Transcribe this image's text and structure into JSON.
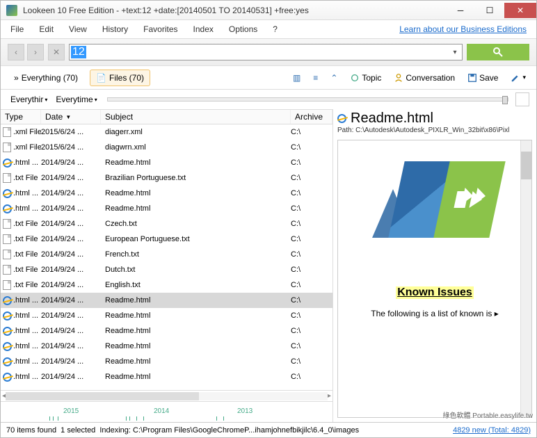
{
  "title": "Lookeen 10 Free Edition - +text:12 +date:[20140501 TO 20140531] +free:yes",
  "menu": {
    "file": "File",
    "edit": "Edit",
    "view": "View",
    "history": "History",
    "favorites": "Favorites",
    "index": "Index",
    "options": "Options",
    "help": "?",
    "link": "Learn about our Business Editions"
  },
  "search": {
    "value": "12"
  },
  "tabs": {
    "everything": "Everything (70)",
    "files": "Files (70)"
  },
  "tb2": {
    "topic": "Topic",
    "conv": "Conversation",
    "save": "Save"
  },
  "filter": {
    "everything": "Everythir",
    "everytime": "Everytime"
  },
  "cols": {
    "type": "Type",
    "date": "Date",
    "subject": "Subject",
    "archive": "Archive"
  },
  "rows": [
    {
      "ico": "file",
      "type": ".xml File",
      "date": "2015/6/24 ...",
      "subj": "diagerr.xml",
      "arch": "C:\\",
      "sel": false
    },
    {
      "ico": "file",
      "type": ".xml File",
      "date": "2015/6/24 ...",
      "subj": "diagwrn.xml",
      "arch": "C:\\",
      "sel": false
    },
    {
      "ico": "ie",
      "type": ".html ...",
      "date": "2014/9/24 ...",
      "subj": "Readme.html",
      "arch": "C:\\",
      "sel": false
    },
    {
      "ico": "file",
      "type": ".txt File",
      "date": "2014/9/24 ...",
      "subj": "Brazilian Portuguese.txt",
      "arch": "C:\\",
      "sel": false
    },
    {
      "ico": "ie",
      "type": ".html ...",
      "date": "2014/9/24 ...",
      "subj": "Readme.html",
      "arch": "C:\\",
      "sel": false
    },
    {
      "ico": "ie",
      "type": ".html ...",
      "date": "2014/9/24 ...",
      "subj": "Readme.html",
      "arch": "C:\\",
      "sel": false
    },
    {
      "ico": "file",
      "type": ".txt File",
      "date": "2014/9/24 ...",
      "subj": "Czech.txt",
      "arch": "C:\\",
      "sel": false
    },
    {
      "ico": "file",
      "type": ".txt File",
      "date": "2014/9/24 ...",
      "subj": "European Portuguese.txt",
      "arch": "C:\\",
      "sel": false
    },
    {
      "ico": "file",
      "type": ".txt File",
      "date": "2014/9/24 ...",
      "subj": "French.txt",
      "arch": "C:\\",
      "sel": false
    },
    {
      "ico": "file",
      "type": ".txt File",
      "date": "2014/9/24 ...",
      "subj": "Dutch.txt",
      "arch": "C:\\",
      "sel": false
    },
    {
      "ico": "file",
      "type": ".txt File",
      "date": "2014/9/24 ...",
      "subj": "English.txt",
      "arch": "C:\\",
      "sel": false
    },
    {
      "ico": "ie",
      "type": ".html ...",
      "date": "2014/9/24 ...",
      "subj": "Readme.html",
      "arch": "C:\\",
      "sel": true
    },
    {
      "ico": "ie",
      "type": ".html ...",
      "date": "2014/9/24 ...",
      "subj": "Readme.html",
      "arch": "C:\\",
      "sel": false
    },
    {
      "ico": "ie",
      "type": ".html ...",
      "date": "2014/9/24 ...",
      "subj": "Readme.html",
      "arch": "C:\\",
      "sel": false
    },
    {
      "ico": "ie",
      "type": ".html ...",
      "date": "2014/9/24 ...",
      "subj": "Readme.html",
      "arch": "C:\\",
      "sel": false
    },
    {
      "ico": "ie",
      "type": ".html ...",
      "date": "2014/9/24 ...",
      "subj": "Readme.html",
      "arch": "C:\\",
      "sel": false
    },
    {
      "ico": "ie",
      "type": ".html ...",
      "date": "2014/9/24 ...",
      "subj": "Readme.html",
      "arch": "C:\\",
      "sel": false
    }
  ],
  "timeline": {
    "y2015": "2015",
    "y2014": "2014",
    "y2013": "2013"
  },
  "preview": {
    "title": "Readme.html",
    "path": "Path: C:\\Autodesk\\Autodesk_PIXLR_Win_32bit\\x86\\Pixl",
    "known": "Known Issues",
    "following": "The following is a list of known is"
  },
  "status": {
    "found": "70 items found",
    "selected": "1 selected",
    "indexing": "Indexing: C:\\Program Files\\GoogleChromeP...ihamjohnefbikjilc\\6.4_0\\images",
    "link": "4829 new (Total: 4829)"
  },
  "watermark": "綠色軟體 Portable.easylife.tw"
}
